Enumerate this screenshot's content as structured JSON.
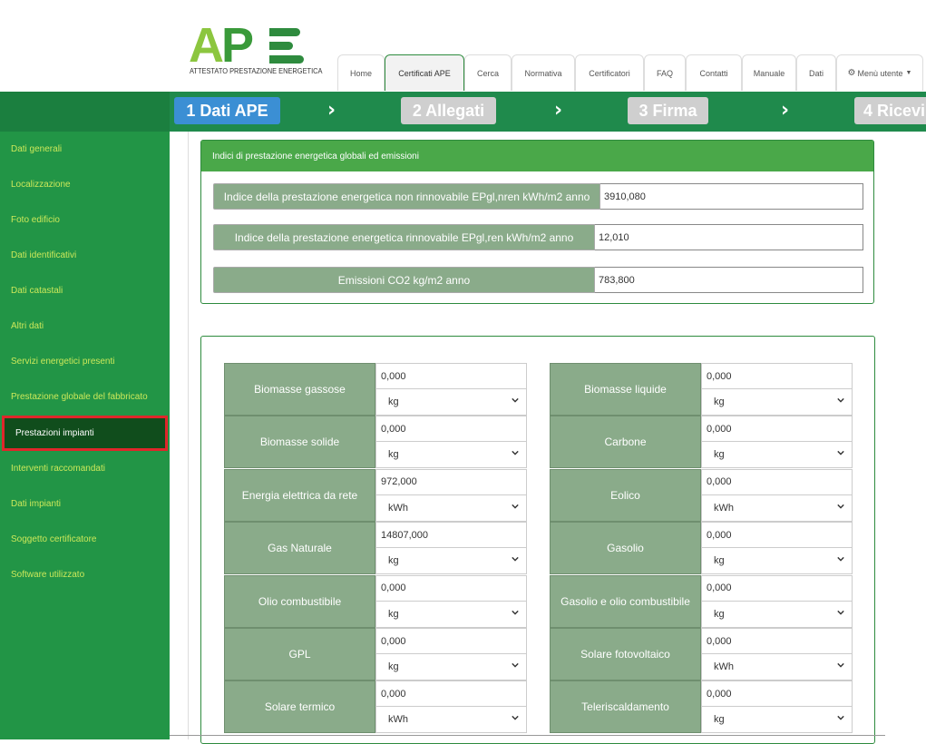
{
  "logo": {
    "letters": "APE",
    "subtitle": "ATTESTATO PRESTAZIONE ENERGETICA"
  },
  "nav_tabs": [
    "Home",
    "Certificati APE",
    "Cerca",
    "Normativa",
    "Certificatori",
    "FAQ",
    "Contatti",
    "Manuale",
    "Dati",
    "Menù utente"
  ],
  "active_tab": "Certificati APE",
  "steps": [
    {
      "label": "1 Dati APE",
      "state": "active"
    },
    {
      "label": "2 Allegati",
      "state": "inactive"
    },
    {
      "label": "3 Firma",
      "state": "inactive"
    },
    {
      "label": "4 Ricevi",
      "state": "inactive"
    }
  ],
  "sidebar": [
    "Dati generali",
    "Localizzazione",
    "Foto edificio",
    "Dati identificativi",
    "Dati catastali",
    "Altri dati",
    "Servizi energetici presenti",
    "Prestazione globale del fabbricato",
    "Prestazioni impianti",
    "Interventi raccomandati",
    "Dati impianti",
    "Soggetto certificatore",
    "Software utilizzato"
  ],
  "sidebar_selected": "Prestazioni impianti",
  "indices_panel": {
    "title": "Indici di prestazione energetica globali ed emissioni",
    "rows": [
      {
        "label": "Indice della prestazione energetica non rinnovabile EPgl,nren kWh/m2 anno",
        "value": "3910,080"
      },
      {
        "label": "Indice della prestazione energetica rinnovabile EPgl,ren kWh/m2 anno",
        "value": "12,010"
      },
      {
        "label": "Emissioni CO2 kg/m2 anno",
        "value": "783,800"
      }
    ]
  },
  "fuels_left": [
    {
      "label": "Biomasse gassose",
      "value": "0,000",
      "unit": "kg"
    },
    {
      "label": "Biomasse solide",
      "value": "0,000",
      "unit": "kg"
    },
    {
      "label": "Energia elettrica da rete",
      "value": "972,000",
      "unit": "kWh"
    },
    {
      "label": "Gas Naturale",
      "value": "14807,000",
      "unit": "kg"
    },
    {
      "label": "Olio combustibile",
      "value": "0,000",
      "unit": "kg"
    },
    {
      "label": "GPL",
      "value": "0,000",
      "unit": "kg"
    },
    {
      "label": "Solare termico",
      "value": "0,000",
      "unit": "kWh"
    }
  ],
  "fuels_right": [
    {
      "label": "Biomasse liquide",
      "value": "0,000",
      "unit": "kg"
    },
    {
      "label": "Carbone",
      "value": "0,000",
      "unit": "kg"
    },
    {
      "label": "Eolico",
      "value": "0,000",
      "unit": "kWh"
    },
    {
      "label": "Gasolio",
      "value": "0,000",
      "unit": "kg"
    },
    {
      "label": "Gasolio e olio combustibile",
      "value": "0,000",
      "unit": "kg"
    },
    {
      "label": "Solare fotovoltaico",
      "value": "0,000",
      "unit": "kWh"
    },
    {
      "label": "Teleriscaldamento",
      "value": "0,000",
      "unit": "kg"
    }
  ],
  "colors": {
    "brand_green": "#229546",
    "dark_green": "#104d1c",
    "step_active": "#3b8fd4",
    "label_bg": "#8aab8a",
    "highlight": "#e0262b"
  }
}
